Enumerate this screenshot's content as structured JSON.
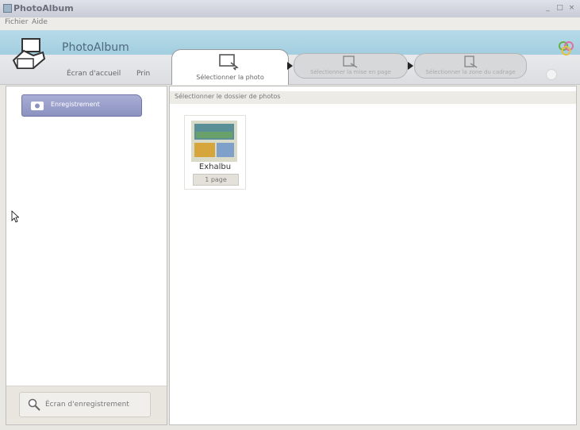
{
  "window": {
    "title": "PhotoAlbum",
    "controls": [
      "_",
      "□",
      "×"
    ]
  },
  "menu": {
    "items": [
      "Fichier",
      "Aide"
    ]
  },
  "header": {
    "app_name": "PhotoAlbum",
    "home_label": "Écran d'accueil",
    "print_label": "Prin"
  },
  "steps": [
    {
      "label": "Sélectionner la photo",
      "active": true
    },
    {
      "label": "Sélectionner la mise en page",
      "active": false
    },
    {
      "label": "Sélectionner la zone du cadrage",
      "active": false
    }
  ],
  "sidebar": {
    "folder_label": "Enregistrement",
    "save_button": "Écran d'enregistrement"
  },
  "main": {
    "header_text": "Sélectionner le dossier de photos",
    "albums": [
      {
        "name": "Exhalbu",
        "count": "1 page"
      }
    ]
  },
  "colors": {
    "header_blue": "#a2cee0",
    "folder_purple": "#8c92c0",
    "accent_green": "#68b04a"
  }
}
